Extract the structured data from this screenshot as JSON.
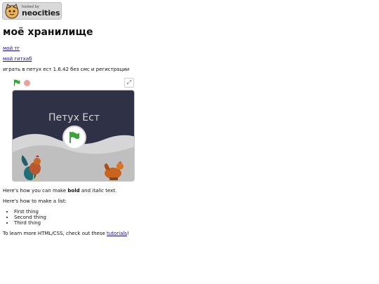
{
  "badge": {
    "small": "hosted by",
    "big": "neocities"
  },
  "page_title": "моё хранилище",
  "links": {
    "tg": "мой тг",
    "github": "мой гитхаб"
  },
  "intro": "играть в петух ест 1.6.42 без смс и регистрации",
  "game": {
    "title": "Петух Ест",
    "fullscreen_icon": "⤢"
  },
  "bold_sentence": {
    "before": "Here's how you can make ",
    "bold": "bold",
    "middle": " and ",
    "italic": "italic",
    "after": " text."
  },
  "list_intro": "Here's how to make a list:",
  "list_items": [
    "First thing",
    "Second thing",
    "Third thing"
  ],
  "learn": {
    "before": "To learn more HTML/CSS, check out these ",
    "link": "tutorials",
    "after": "!"
  },
  "colors": {
    "stage_bg": "#2f3247",
    "hills": "#c8c8c8",
    "flag_green": "#3aa63a",
    "link": "#1a0dab"
  }
}
